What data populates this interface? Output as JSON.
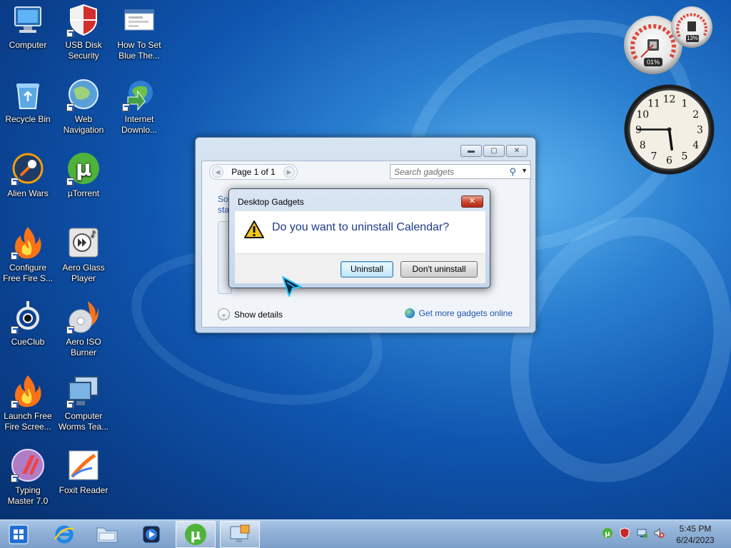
{
  "desktop": {
    "icons": [
      {
        "label": "Computer",
        "icon": "computer-icon"
      },
      {
        "label": "USB Disk\nSecurity",
        "icon": "usb-disk-security-icon"
      },
      {
        "label": "How To Set\nBlue The...",
        "icon": "document-icon"
      },
      {
        "label": "Recycle Bin",
        "icon": "recycle-bin-icon"
      },
      {
        "label": "Web\nNavigation",
        "icon": "globe-icon"
      },
      {
        "label": "Internet\nDownlo...",
        "icon": "internet-download-manager-icon"
      },
      {
        "label": "Alien Wars",
        "icon": "alien-wars-icon"
      },
      {
        "label": "µTorrent",
        "icon": "utorrent-icon"
      },
      {
        "label": "Configure\nFree Fire S...",
        "icon": "flame-icon"
      },
      {
        "label": "Aero Glass\nPlayer",
        "icon": "media-player-icon"
      },
      {
        "label": "CueClub",
        "icon": "cueclub-icon"
      },
      {
        "label": "Aero ISO\nBurner",
        "icon": "disc-burner-icon"
      },
      {
        "label": "Launch Free\nFire Scree...",
        "icon": "flame-icon"
      },
      {
        "label": "Computer\nWorms Tea...",
        "icon": "monitor-icon"
      },
      {
        "label": "Typing\nMaster 7.0",
        "icon": "typing-master-icon"
      },
      {
        "label": "Foxit Reader",
        "icon": "foxit-reader-icon"
      }
    ]
  },
  "gadgets_window": {
    "page_label": "Page 1 of 1",
    "search_placeholder": "Search gadgets",
    "partial_text": "Sor\nstat",
    "show_details": "Show details",
    "get_more": "Get more gadgets online"
  },
  "dialog": {
    "title": "Desktop Gadgets",
    "close_label": "✕",
    "question": "Do you want to uninstall Calendar?",
    "uninstall_label": "Uninstall",
    "dont_uninstall_label": "Don't uninstall"
  },
  "cpu_gadget": {
    "cpu_percent": "01%",
    "memory_percent": "13%"
  },
  "clock_gadget": {
    "numbers": [
      "12",
      "1",
      "2",
      "3",
      "4",
      "5",
      "6",
      "7",
      "8",
      "9",
      "10",
      "11"
    ],
    "time": "5:45"
  },
  "taskbar": {
    "time": "5:45 PM",
    "date": "6/24/2023",
    "buttons": [
      "start-button",
      "internet-explorer",
      "file-explorer",
      "media-player",
      "utorrent",
      "desktop-gadgets"
    ]
  },
  "colors": {
    "accent": "#1e3a8a",
    "link": "#1e55a7",
    "close_red": "#c9442d"
  }
}
